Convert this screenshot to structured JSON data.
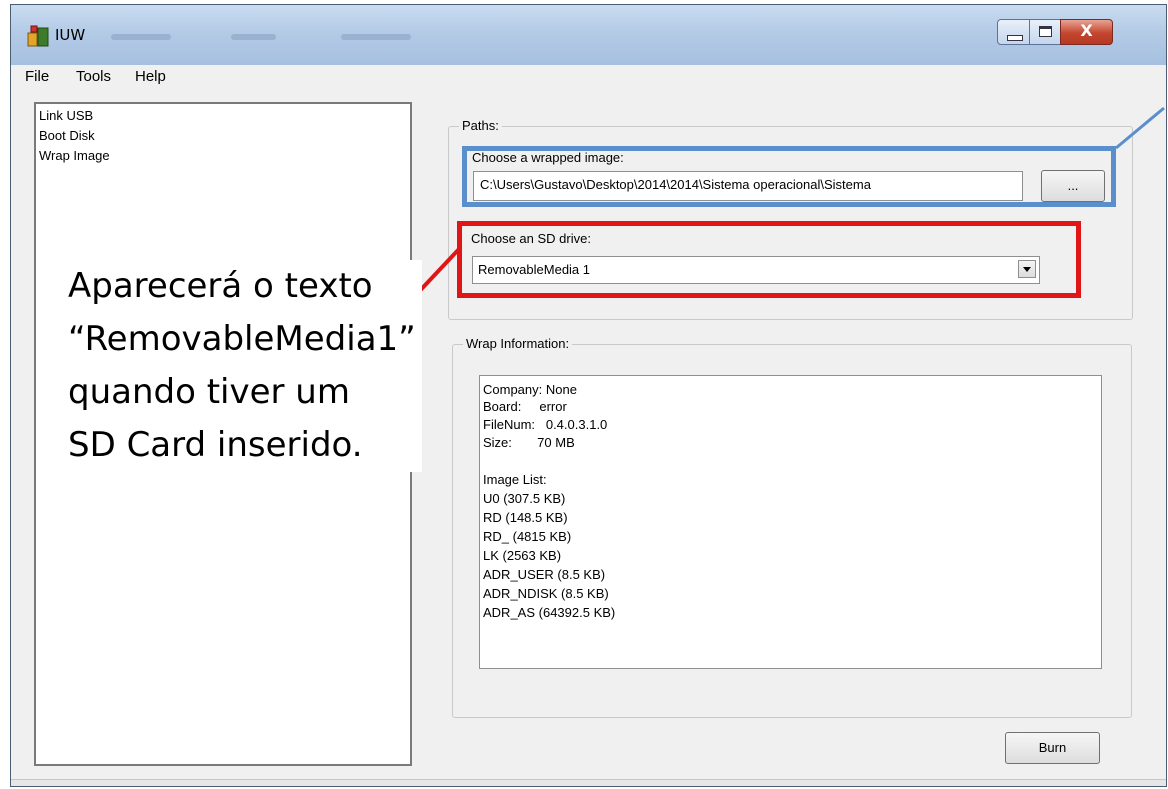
{
  "window": {
    "title": "IUW",
    "controls": {
      "close_label": "X"
    }
  },
  "menu": [
    "File",
    "Tools",
    "Help"
  ],
  "sidebar": {
    "items": [
      "Link USB",
      "Boot Disk",
      "Wrap Image"
    ]
  },
  "paths": {
    "group_label": "Paths:",
    "image_label": "Choose a wrapped image:",
    "image_value": "C:\\Users\\Gustavo\\Desktop\\2014\\2014\\Sistema operacional\\Sistema",
    "browse_label": "...",
    "sd_label": "Choose an SD drive:",
    "sd_value": "RemovableMedia 1"
  },
  "wrap_info": {
    "group_label": "Wrap Information:",
    "lines": [
      "Company: None",
      "Board:     error",
      "FileNum:   0.4.0.3.1.0",
      "Size:       70 MB",
      "",
      "Image List:",
      "U0 (307.5 KB)",
      "RD (148.5 KB)",
      "RD_ (4815 KB)",
      "LK (2563 KB)",
      "ADR_USER (8.5 KB)",
      "ADR_NDISK (8.5 KB)",
      "ADR_AS (64392.5 KB)"
    ]
  },
  "burn_label": "Burn",
  "annotation": {
    "lines": [
      "Aparecerá o texto",
      "“RemovableMedia1”",
      "quando tiver um",
      "SD Card inserido."
    ],
    "highlight_blue": "#5b8fcc",
    "highlight_red": "#e01616"
  }
}
